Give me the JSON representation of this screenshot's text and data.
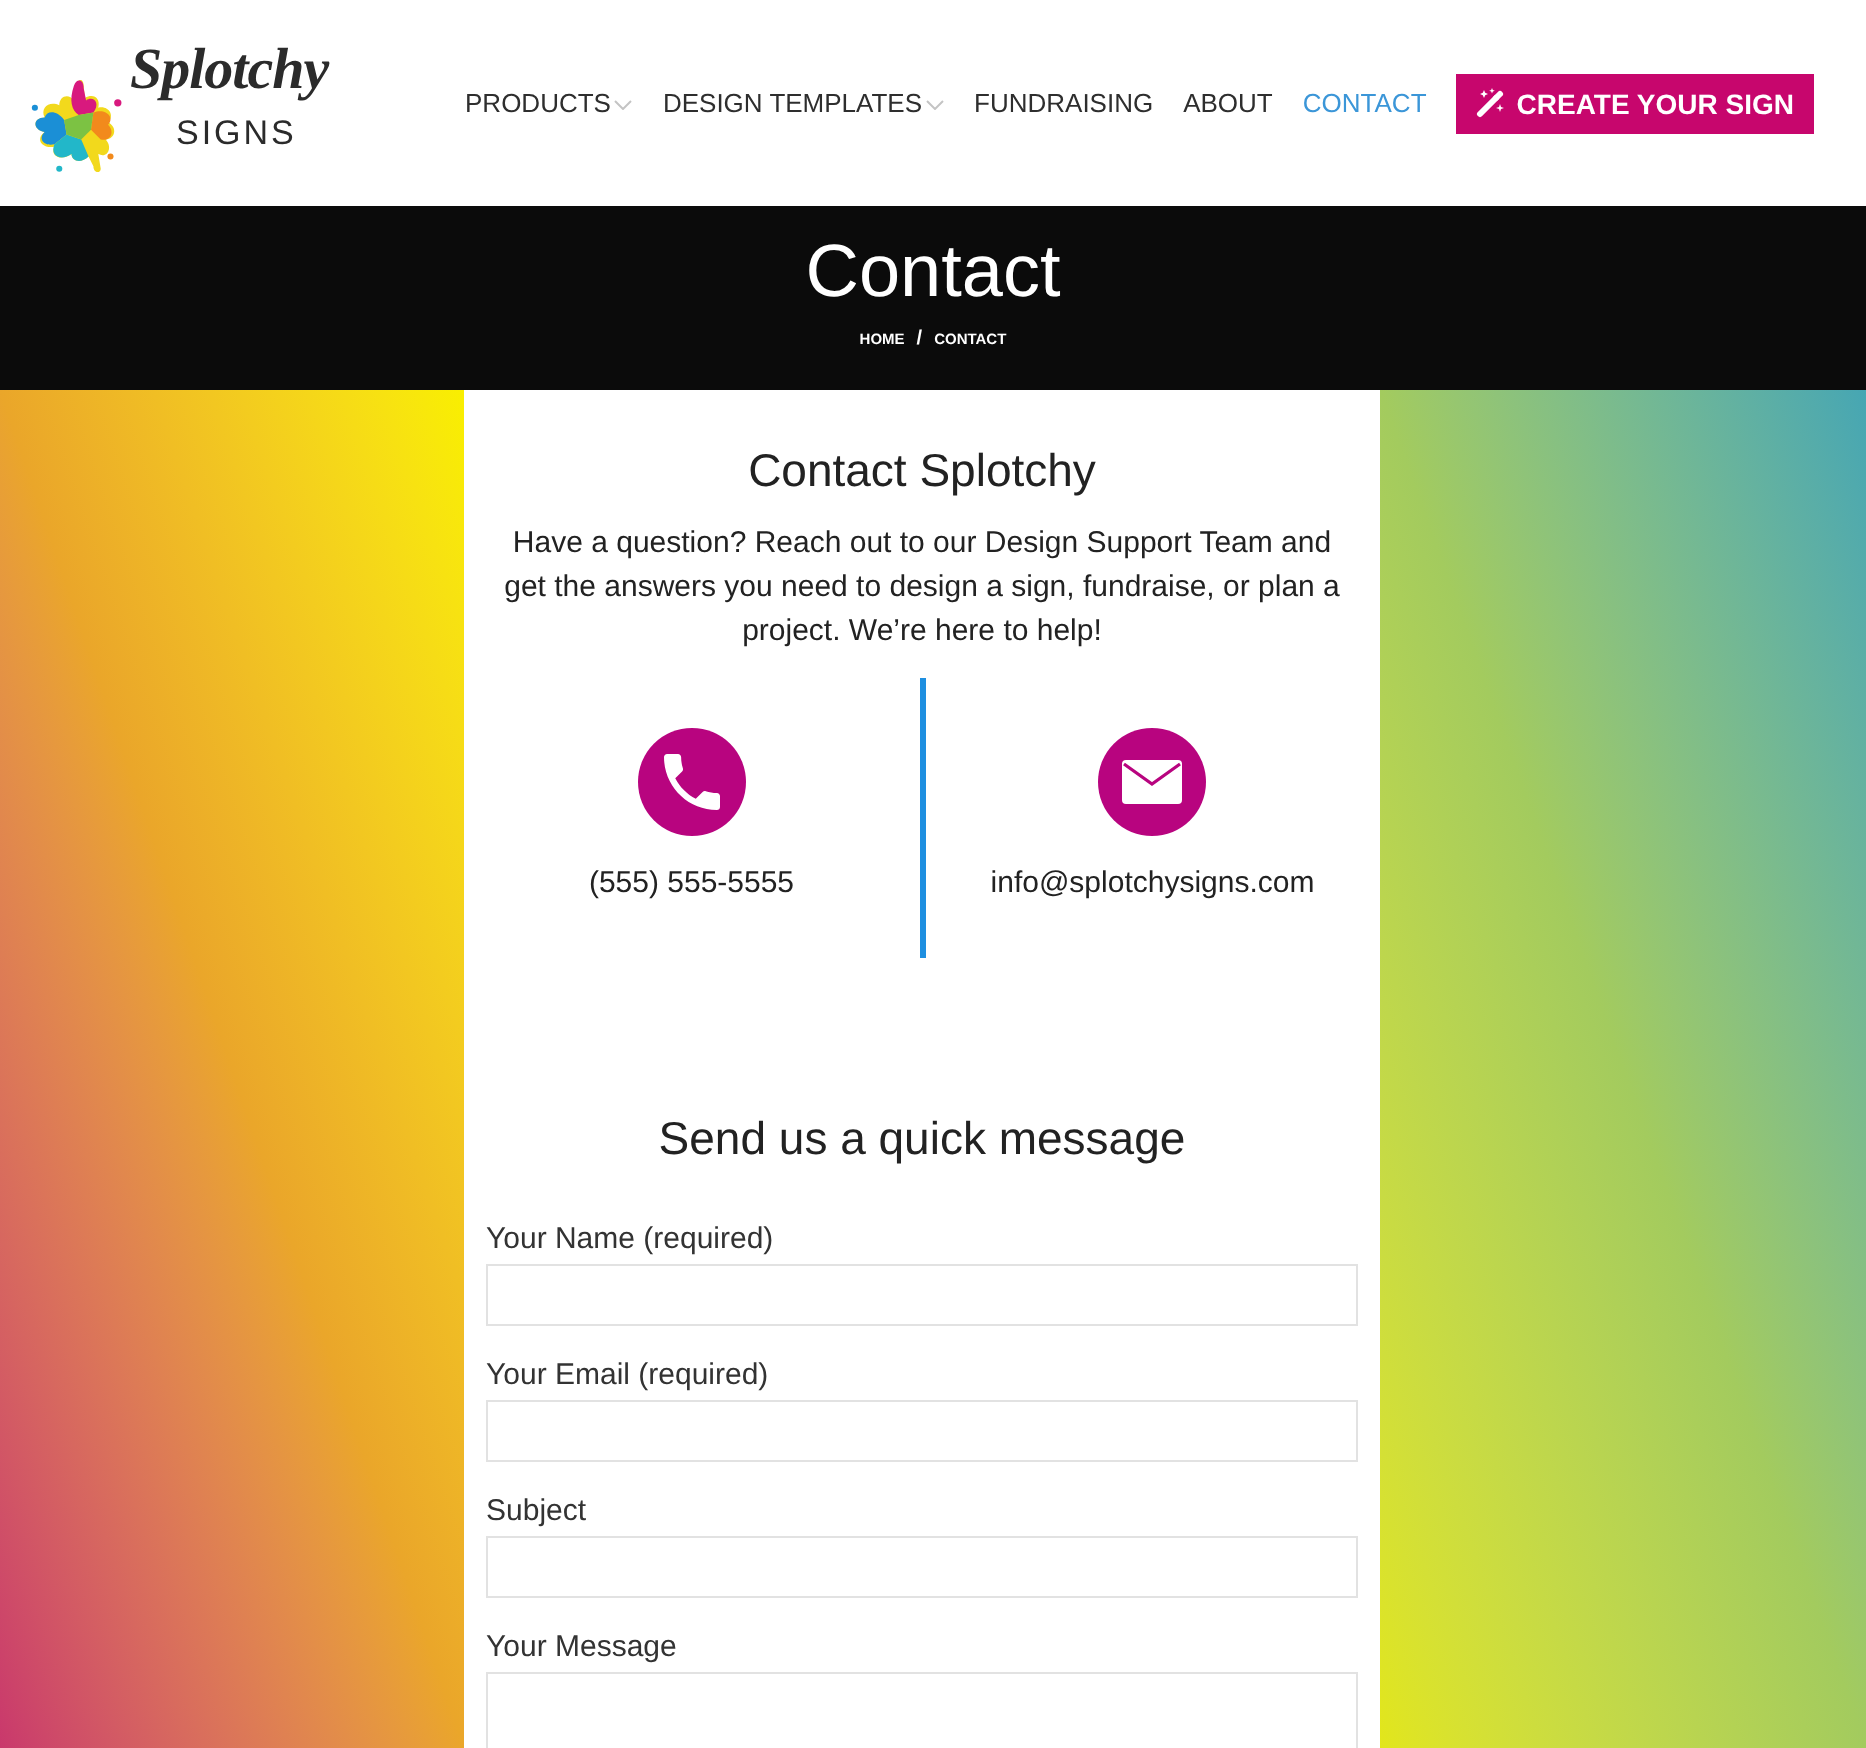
{
  "header": {
    "logo": {
      "script": "Splotchy",
      "word": "SIGNS"
    },
    "nav": [
      {
        "label": "PRODUCTS",
        "dropdown": true,
        "selected": false
      },
      {
        "label": "DESIGN TEMPLATES",
        "dropdown": true,
        "selected": false
      },
      {
        "label": "FUNDRAISING",
        "dropdown": false,
        "selected": false
      },
      {
        "label": "ABOUT",
        "dropdown": false,
        "selected": false
      },
      {
        "label": "CONTACT",
        "dropdown": false,
        "selected": true
      }
    ],
    "cta": {
      "label": "CREATE YOUR SIGN"
    }
  },
  "banner": {
    "title": "Contact",
    "breadcrumb": [
      {
        "label": "HOME"
      },
      {
        "label": "CONTACT"
      }
    ],
    "separator": "/"
  },
  "contact": {
    "title": "Contact Splotchy",
    "intro": "Have a question? Reach out to our Design Support Team and get the answers you need to design a sign, fundraise, or plan a project. We’re here to help!",
    "methods": [
      {
        "kind": "phone",
        "text": "(555) 555-5555"
      },
      {
        "kind": "email",
        "text": "info@splotchysigns.com"
      }
    ]
  },
  "form": {
    "title": "Send us a quick message",
    "fields": [
      {
        "label": "Your Name (required)",
        "kind": "text"
      },
      {
        "label": "Your Email (required)",
        "kind": "text"
      },
      {
        "label": "Subject",
        "kind": "text"
      },
      {
        "label": "Your Message",
        "kind": "textarea"
      }
    ]
  }
}
